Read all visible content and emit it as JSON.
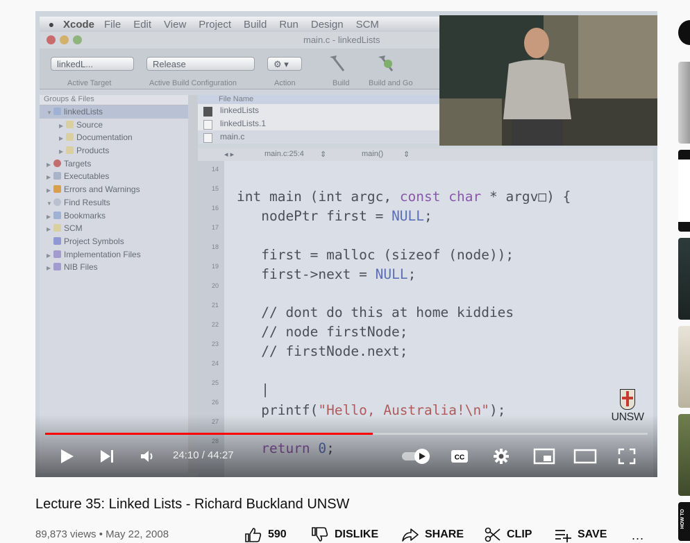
{
  "xcode": {
    "menubar": [
      "Xcode",
      "File",
      "Edit",
      "View",
      "Project",
      "Build",
      "Run",
      "Design",
      "SCM"
    ],
    "window_title": "main.c - linkedLists",
    "toolbar": {
      "target_value": "linkedL...",
      "config_value": "Release",
      "labels": [
        "Active Target",
        "Active Build Configuration",
        "Action",
        "Build",
        "Build and Go"
      ]
    },
    "groups_header": "Groups & Files",
    "groups": [
      "linkedLists",
      "Source",
      "Documentation",
      "Products",
      "Targets",
      "Executables",
      "Errors and Warnings",
      "Find Results",
      "Bookmarks",
      "SCM",
      "Project Symbols",
      "Implementation Files",
      "NIB Files"
    ],
    "files_header": "File Name",
    "files": [
      "linkedLists",
      "linkedLists.1",
      "main.c"
    ],
    "navbar": {
      "file": "main.c:25:4",
      "func": "main()"
    },
    "line_numbers": [
      "14",
      "15",
      "16",
      "17",
      "18",
      "19",
      "20",
      "21",
      "22",
      "23",
      "24",
      "25",
      "26",
      "27",
      "28"
    ],
    "code": {
      "l15a": "int main (int argc, ",
      "l15b": "const char",
      "l15c": " * argv□) {",
      "l16a": "   nodePtr first = ",
      "l16b": "NULL",
      "l16c": ";",
      "l18": "   first = malloc (sizeof (node));",
      "l19a": "   first->next = ",
      "l19b": "NULL",
      "l19c": ";",
      "l21": "   // dont do this at home kiddies",
      "l22": "   // node firstNode;",
      "l23": "   // firstNode.next;",
      "l25": "   |",
      "l26a": "   printf(",
      "l26b": "\"Hello, Australia!\\n\"",
      "l26c": ");",
      "l28a": "   return ",
      "l28b": "0",
      "l28c": ";"
    },
    "logo_text": "UNSW"
  },
  "player": {
    "current_time": "24:10",
    "duration": "44:27",
    "time_display": "24:10 / 44:27",
    "progress_fraction": 0.5436,
    "autoplay_on": true,
    "icons": [
      "play-icon",
      "next-icon",
      "volume-icon",
      "autoplay-toggle",
      "cc-icon",
      "settings-icon",
      "miniplayer-icon",
      "theater-icon",
      "fullscreen-icon"
    ],
    "accent": "#ff0000"
  },
  "video": {
    "title": "Lecture 35: Linked Lists - Richard Buckland UNSW",
    "meta": "89,873 views • May 22, 2008",
    "likes": "590",
    "dislike_label": "DISLIKE",
    "share_label": "SHARE",
    "clip_label": "CLIP",
    "save_label": "SAVE",
    "more_label": "..."
  },
  "rail": {
    "bottom_badge": "HOW TO"
  }
}
